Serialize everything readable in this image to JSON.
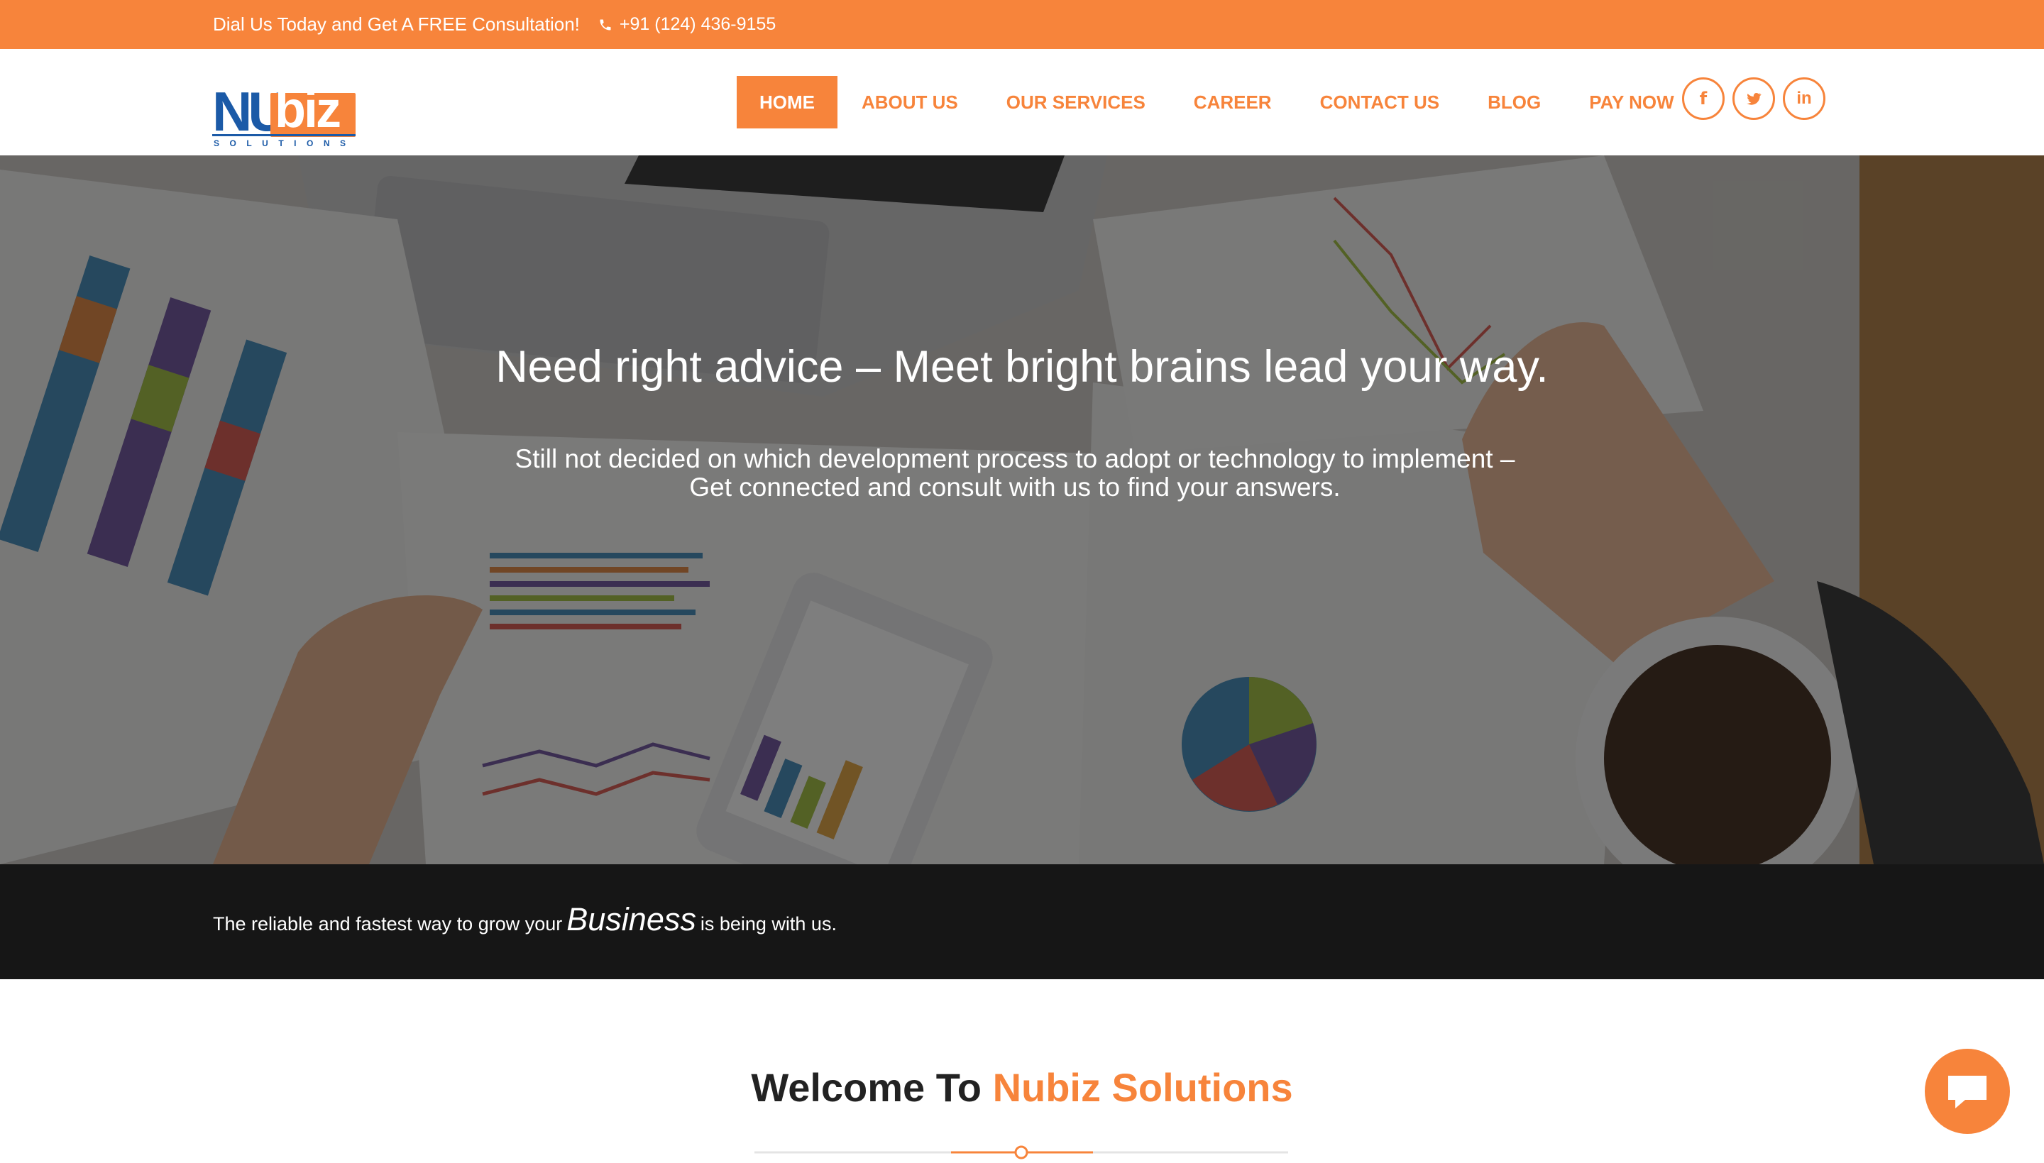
{
  "topbar": {
    "tagline": "Dial Us Today and Get A FREE Consultation!",
    "phone": "+91 (124) 436-9155",
    "phone_icon": "phone-icon"
  },
  "brand": {
    "logo_primary": "NU",
    "logo_secondary": "biz",
    "logo_subtitle": "SOLUTIONS",
    "accent_color": "#f7843b",
    "logo_blue": "#1b5aa7"
  },
  "nav": {
    "items": [
      {
        "label": "HOME",
        "active": true
      },
      {
        "label": "ABOUT US"
      },
      {
        "label": "OUR SERVICES"
      },
      {
        "label": "CAREER"
      },
      {
        "label": "CONTACT US"
      },
      {
        "label": "BLOG"
      },
      {
        "label": "PAY NOW"
      }
    ]
  },
  "social": [
    {
      "icon": "facebook-icon",
      "glyph": "f"
    },
    {
      "icon": "twitter-icon"
    },
    {
      "icon": "linkedin-icon",
      "glyph": "in"
    }
  ],
  "hero": {
    "headline": "Need right advice – Meet bright brains lead your way.",
    "subline_1": "Still not decided on which development process to adopt or technology to implement –",
    "subline_2": "Get connected and consult with us to find your answers."
  },
  "strip": {
    "before": "The reliable and fastest way to grow your",
    "emphasis": "Business",
    "after": "is being with us."
  },
  "welcome": {
    "prefix": "Welcome To",
    "brand": "Nubiz Solutions"
  },
  "chat": {
    "icon": "chat-bubble-icon"
  }
}
